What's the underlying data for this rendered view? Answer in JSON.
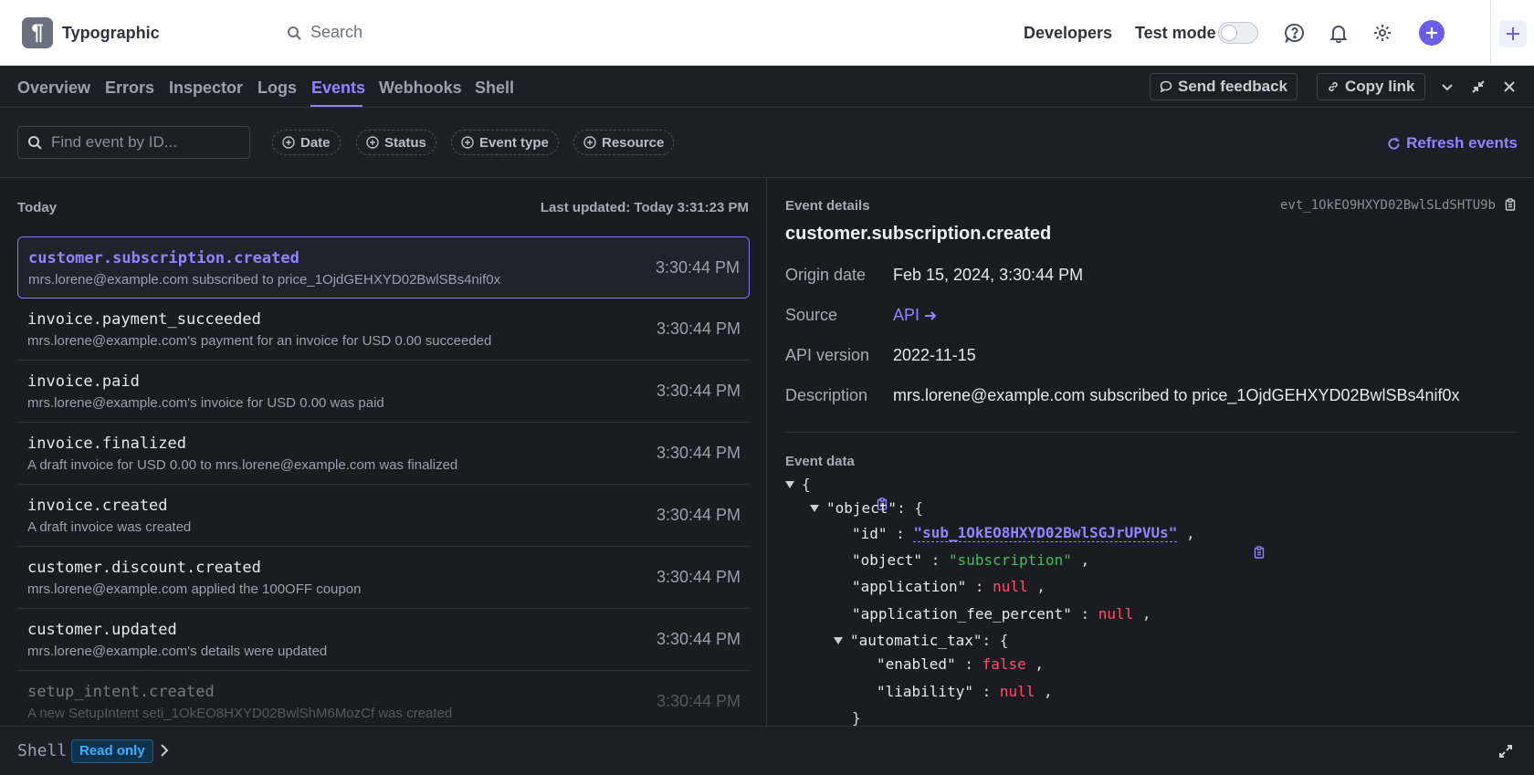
{
  "header": {
    "brand": "Typographic",
    "search_placeholder": "Search",
    "developers": "Developers",
    "test_mode": "Test mode"
  },
  "tabs": [
    "Overview",
    "Errors",
    "Inspector",
    "Logs",
    "Events",
    "Webhooks",
    "Shell"
  ],
  "active_tab": "Events",
  "actions": {
    "send_feedback": "Send feedback",
    "copy_link": "Copy link"
  },
  "filters": {
    "find_placeholder": "Find event by ID...",
    "chips": [
      "Date",
      "Status",
      "Event type",
      "Resource"
    ],
    "refresh": "Refresh events"
  },
  "list": {
    "section": "Today",
    "last_updated": "Last updated: Today 3:31:23 PM",
    "events": [
      {
        "name": "customer.subscription.created",
        "desc": "mrs.lorene@example.com subscribed to price_1OjdGEHXYD02BwlSBs4nif0x",
        "time": "3:30:44 PM"
      },
      {
        "name": "invoice.payment_succeeded",
        "desc": "mrs.lorene@example.com's payment for an invoice for USD 0.00 succeeded",
        "time": "3:30:44 PM"
      },
      {
        "name": "invoice.paid",
        "desc": "mrs.lorene@example.com's invoice for USD 0.00 was paid",
        "time": "3:30:44 PM"
      },
      {
        "name": "invoice.finalized",
        "desc": "A draft invoice for USD 0.00 to mrs.lorene@example.com was finalized",
        "time": "3:30:44 PM"
      },
      {
        "name": "invoice.created",
        "desc": "A draft invoice was created",
        "time": "3:30:44 PM"
      },
      {
        "name": "customer.discount.created",
        "desc": "mrs.lorene@example.com applied the 100OFF coupon",
        "time": "3:30:44 PM"
      },
      {
        "name": "customer.updated",
        "desc": "mrs.lorene@example.com's details were updated",
        "time": "3:30:44 PM"
      },
      {
        "name": "setup_intent.created",
        "desc": "A new SetupIntent seti_1OkEO8HXYD02BwlShM6MozCf was created",
        "time": "3:30:44 PM"
      }
    ]
  },
  "details": {
    "label": "Event details",
    "event_id": "evt_1OkEO9HXYD02BwlSLdSHTU9b",
    "title": "customer.subscription.created",
    "origin_label": "Origin date",
    "origin_value": "Feb 15, 2024, 3:30:44 PM",
    "source_label": "Source",
    "source_value": "API",
    "api_label": "API version",
    "api_value": "2022-11-15",
    "desc_label": "Description",
    "desc_value": "mrs.lorene@example.com subscribed to price_1OjdGEHXYD02BwlSBs4nif0x",
    "event_data_label": "Event data"
  },
  "json": {
    "open_brace": "{",
    "object_key": "\"object\"",
    "id_key": "\"id\"",
    "id_value": "\"sub_1OkEO8HXYD02BwlSGJrUPVUs\"",
    "object2_key": "\"object\"",
    "object2_value": "\"subscription\"",
    "application_key": "\"application\"",
    "application_fee_key": "\"application_fee_percent\"",
    "automatic_tax_key": "\"automatic_tax\"",
    "enabled_key": "\"enabled\"",
    "enabled_value": "false",
    "liability_key": "\"liability\"",
    "null": "null",
    "close_brace": "}"
  },
  "shell": {
    "label": "Shell",
    "badge": "Read only"
  },
  "colors": {
    "accent": "#8f86ff",
    "string": "#3fbf5a",
    "null": "#ff4d6a",
    "info": "#3ab0ff"
  }
}
